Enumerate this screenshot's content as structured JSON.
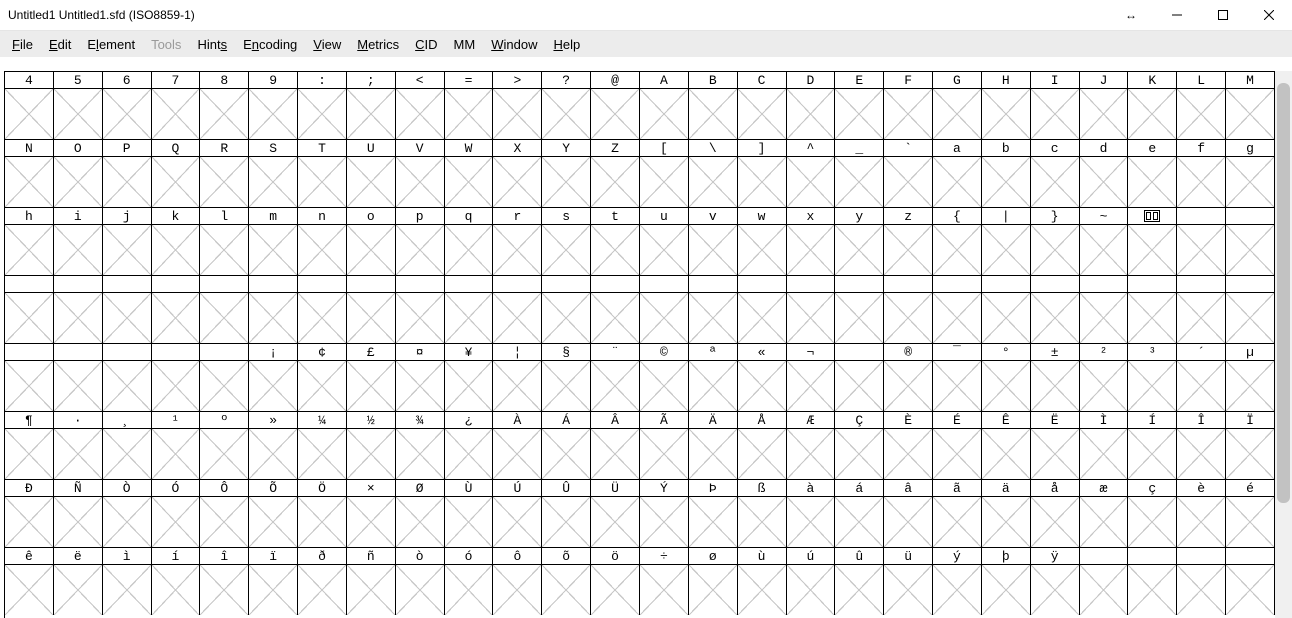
{
  "window": {
    "title": "Untitled1  Untitled1.sfd (ISO8859-1)"
  },
  "menu": {
    "items": [
      {
        "label": "File",
        "ul": 0,
        "disabled": false
      },
      {
        "label": "Edit",
        "ul": 0,
        "disabled": false
      },
      {
        "label": "Element",
        "ul": 1,
        "disabled": false
      },
      {
        "label": "Tools",
        "ul": -1,
        "disabled": true
      },
      {
        "label": "Hints",
        "ul": 4,
        "disabled": false
      },
      {
        "label": "Encoding",
        "ul": 1,
        "disabled": false
      },
      {
        "label": "View",
        "ul": 0,
        "disabled": false
      },
      {
        "label": "Metrics",
        "ul": 0,
        "disabled": false
      },
      {
        "label": "CID",
        "ul": 0,
        "disabled": false
      },
      {
        "label": "MM",
        "ul": -1,
        "disabled": false
      },
      {
        "label": "Window",
        "ul": 0,
        "disabled": false
      },
      {
        "label": "Help",
        "ul": 0,
        "disabled": false
      }
    ]
  },
  "grid": {
    "columns": 26,
    "rows": [
      [
        "4",
        "5",
        "6",
        "7",
        "8",
        "9",
        ":",
        ";",
        "<",
        "=",
        ">",
        "?",
        "@",
        "A",
        "B",
        "C",
        "D",
        "E",
        "F",
        "G",
        "H",
        "I",
        "J",
        "K",
        "L",
        "M"
      ],
      [
        "N",
        "O",
        "P",
        "Q",
        "R",
        "S",
        "T",
        "U",
        "V",
        "W",
        "X",
        "Y",
        "Z",
        "[",
        "\\",
        "]",
        "^",
        "_",
        "`",
        "a",
        "b",
        "c",
        "d",
        "e",
        "f",
        "g"
      ],
      [
        "h",
        "i",
        "j",
        "k",
        "l",
        "m",
        "n",
        "o",
        "p",
        "q",
        "r",
        "s",
        "t",
        "u",
        "v",
        "w",
        "x",
        "y",
        "z",
        "{",
        "|",
        "}",
        "~",
        "",
        "",
        ""
      ],
      [
        "",
        "",
        "",
        "",
        "",
        "",
        "",
        "",
        "",
        "",
        "",
        "",
        "",
        "",
        "",
        "",
        "",
        "",
        "",
        "",
        "",
        "",
        "",
        "",
        "",
        ""
      ],
      [
        "",
        "",
        "",
        "",
        "",
        "¡",
        "¢",
        "£",
        "¤",
        "¥",
        "¦",
        "§",
        "¨",
        "©",
        "ª",
        "«",
        "¬",
        "­",
        "®",
        "¯",
        "°",
        "±",
        "²",
        "³",
        "´",
        "µ"
      ],
      [
        "¶",
        "·",
        "¸",
        "¹",
        "º",
        "»",
        "¼",
        "½",
        "¾",
        "¿",
        "À",
        "Á",
        "Â",
        "Ã",
        "Ä",
        "Å",
        "Æ",
        "Ç",
        "È",
        "É",
        "Ê",
        "Ë",
        "Ì",
        "Í",
        "Î",
        "Ï"
      ],
      [
        "Ð",
        "Ñ",
        "Ò",
        "Ó",
        "Ô",
        "Õ",
        "Ö",
        "×",
        "Ø",
        "Ù",
        "Ú",
        "Û",
        "Ü",
        "Ý",
        "Þ",
        "ß",
        "à",
        "á",
        "â",
        "ã",
        "ä",
        "å",
        "æ",
        "ç",
        "è",
        "é"
      ],
      [
        "ê",
        "ë",
        "ì",
        "í",
        "î",
        "ï",
        "ð",
        "ñ",
        "ò",
        "ó",
        "ô",
        "õ",
        "ö",
        "÷",
        "ø",
        "ù",
        "ú",
        "û",
        "ü",
        "ý",
        "þ",
        "ÿ",
        "",
        "",
        "",
        ""
      ]
    ]
  }
}
